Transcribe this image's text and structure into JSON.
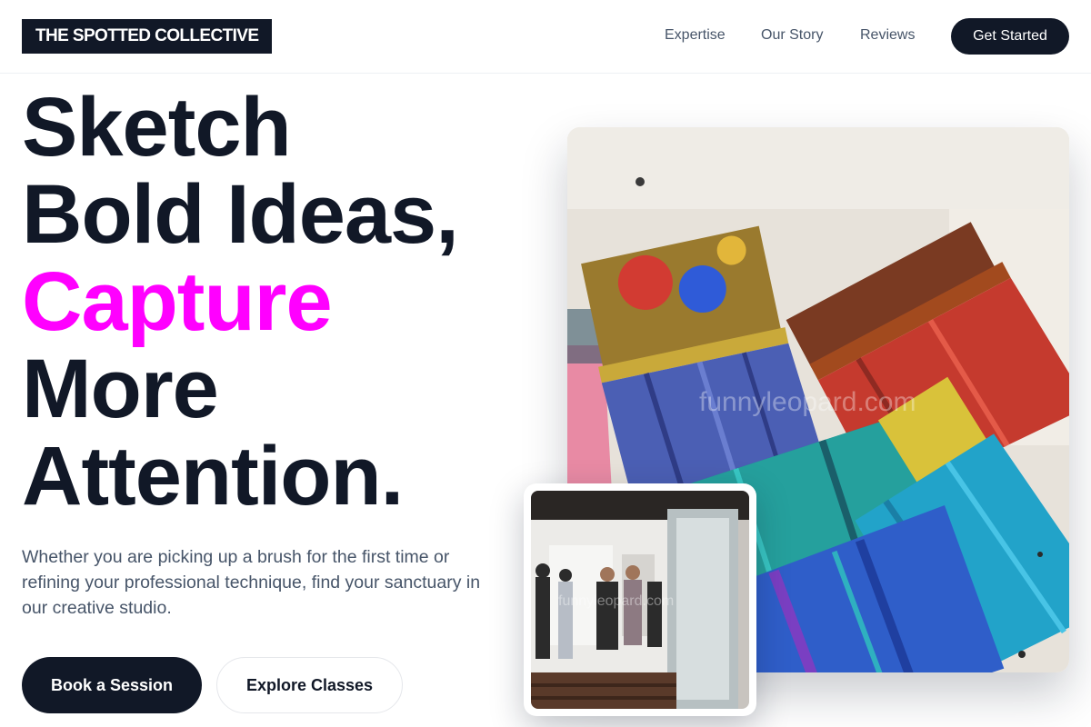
{
  "header": {
    "logo": "THE SPOTTED COLLECTIVE",
    "nav": [
      "Expertise",
      "Our Story",
      "Reviews"
    ],
    "cta": "Get Started"
  },
  "hero": {
    "headline": [
      "Sketch",
      "Bold Ideas,",
      "Capture",
      "More",
      "Attention."
    ],
    "subtitle": "Whether you are picking up a brush for the first time or refining your professional technique, find your sanctuary in our creative studio.",
    "primary_button": "Book a Session",
    "secondary_button": "Explore Classes",
    "accent_color": "#ff00ff"
  },
  "images": {
    "main": {
      "subject": "paint-brushes-photo",
      "watermark": "funnyleopard.com"
    },
    "inset": {
      "subject": "art-gallery-visitors-photo",
      "watermark": "funnyleopard.com"
    }
  }
}
